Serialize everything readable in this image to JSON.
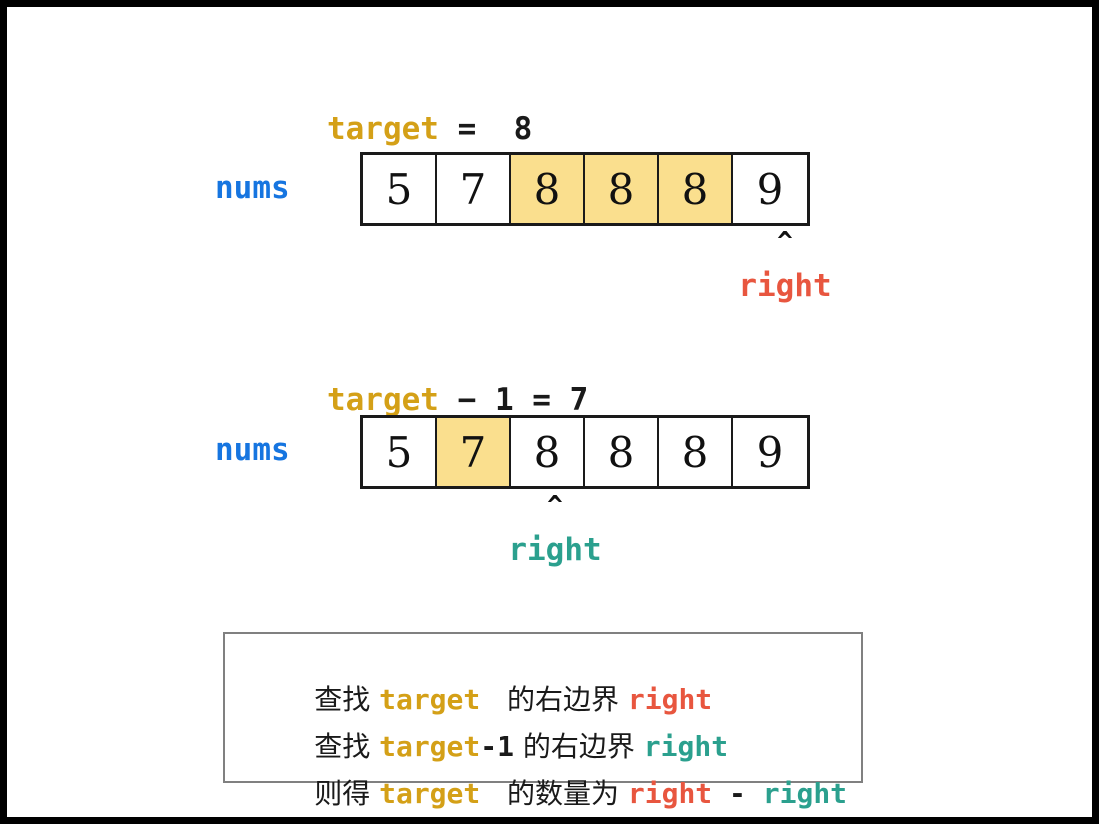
{
  "figure": {
    "title": "binary search right boundary count illustration",
    "colors": {
      "target_gold": "#D4A017",
      "nums_blue": "#1675E0",
      "right_red": "#E8563F",
      "right_teal": "#2BA08E",
      "highlight_yellow": "#FADF8E",
      "cell_border": "#1a1a1a",
      "box_border": "#808080",
      "frame_border": "#000000"
    }
  },
  "sections": [
    {
      "id": "section-upper",
      "expression": {
        "target_label": "target",
        "rest": " =  8"
      },
      "array": {
        "name_label": "nums",
        "cells": [
          {
            "value": "5",
            "highlighted": false
          },
          {
            "value": "7",
            "highlighted": false
          },
          {
            "value": "8",
            "highlighted": true
          },
          {
            "value": "8",
            "highlighted": true
          },
          {
            "value": "8",
            "highlighted": true
          },
          {
            "value": "9",
            "highlighted": false
          }
        ]
      },
      "pointer": {
        "caret": "^",
        "label": "right",
        "index": 5,
        "color": "#E8563F"
      }
    },
    {
      "id": "section-lower",
      "expression": {
        "target_label": "target",
        "rest": " − 1 = 7"
      },
      "array": {
        "name_label": "nums",
        "cells": [
          {
            "value": "5",
            "highlighted": false
          },
          {
            "value": "7",
            "highlighted": true
          },
          {
            "value": "8",
            "highlighted": false
          },
          {
            "value": "8",
            "highlighted": false
          },
          {
            "value": "8",
            "highlighted": false
          },
          {
            "value": "9",
            "highlighted": false
          }
        ]
      },
      "pointer": {
        "caret": "^",
        "label": "right",
        "index": 2,
        "color": "#2BA08E"
      }
    }
  ],
  "note_box": {
    "lines": [
      {
        "prefix": "查找 ",
        "term": "target",
        "suffix_mono": "",
        "middle": "   的右边界 ",
        "value": "right",
        "value_color": "red",
        "operator": "",
        "value2": ""
      },
      {
        "prefix": "查找 ",
        "term": "target",
        "suffix_mono": "-1",
        "middle": " 的右边界 ",
        "value": "right",
        "value_color": "teal",
        "operator": "",
        "value2": ""
      },
      {
        "prefix": "则得 ",
        "term": "target",
        "suffix_mono": "",
        "middle": "   的数量为 ",
        "value": "right",
        "value_color": "red",
        "operator": " - ",
        "value2": "right"
      }
    ]
  }
}
